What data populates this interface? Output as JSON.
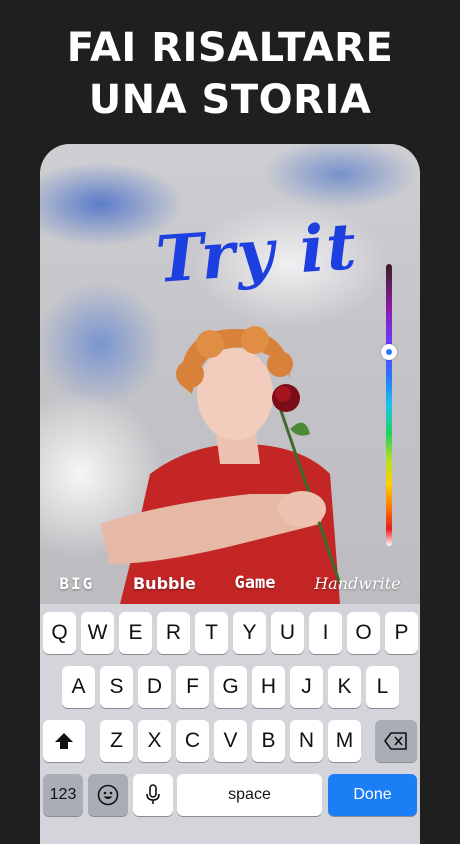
{
  "headline": {
    "line1": "FAI RISALTARE",
    "line2": "UNA STORIA"
  },
  "canvas": {
    "text": "Try it"
  },
  "styles": [
    {
      "label": "BIG"
    },
    {
      "label": "Bubble"
    },
    {
      "label": "Game"
    },
    {
      "label": "Handwrite"
    }
  ],
  "colors": {
    "text_color": "#1e3fe0",
    "done_key": "#1c7ef5",
    "background": "#1f1f1f"
  },
  "color_slider": {
    "position": 0.29
  },
  "keyboard": {
    "row1": [
      "Q",
      "W",
      "E",
      "R",
      "T",
      "Y",
      "U",
      "I",
      "O",
      "P"
    ],
    "row2": [
      "A",
      "S",
      "D",
      "F",
      "G",
      "H",
      "J",
      "K",
      "L"
    ],
    "row3": [
      "Z",
      "X",
      "C",
      "V",
      "B",
      "N",
      "M"
    ],
    "numbers_label": "123",
    "space_label": "space",
    "done_label": "Done",
    "icons": {
      "shift": "shift-icon",
      "delete": "backspace-icon",
      "emoji": "emoji-icon",
      "mic": "microphone-icon"
    }
  }
}
